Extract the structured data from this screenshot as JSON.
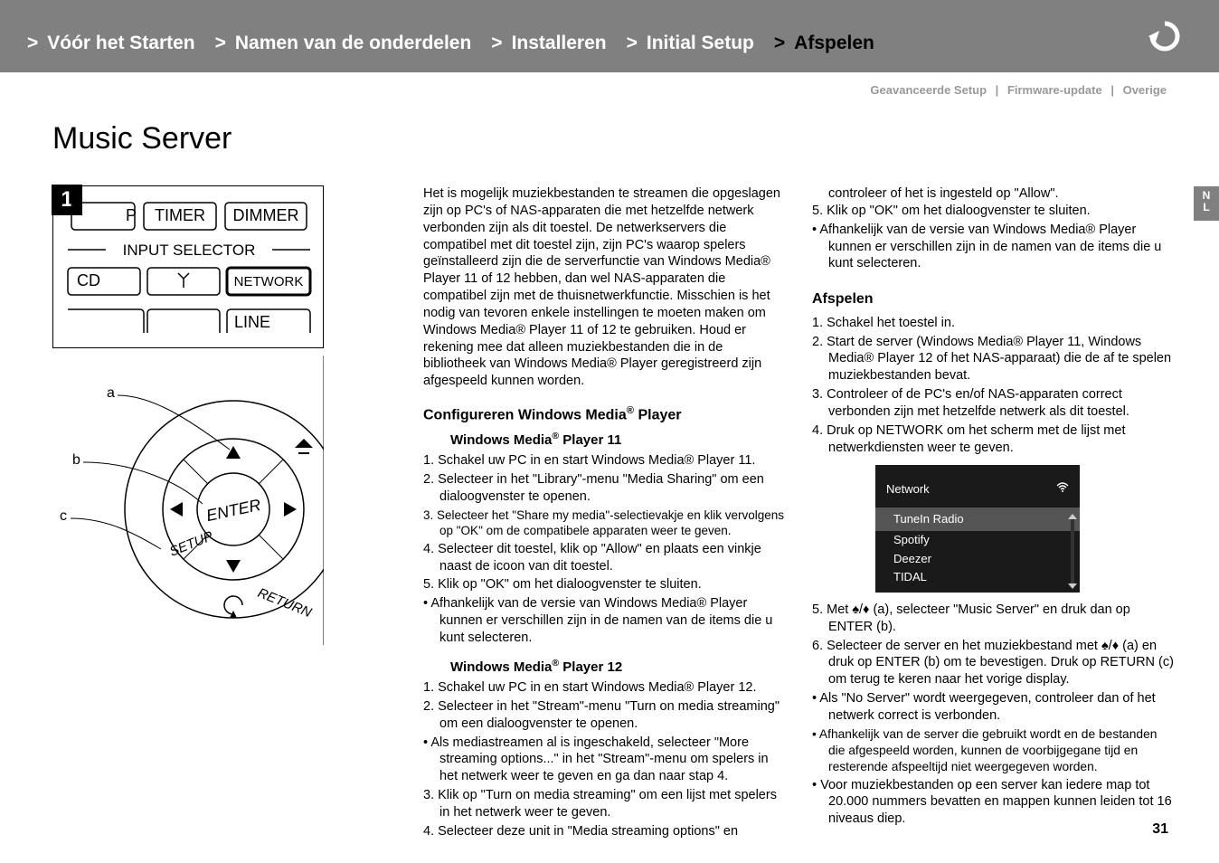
{
  "breadcrumbs": [
    {
      "label": "Vóór het Starten"
    },
    {
      "label": "Namen van de onderdelen"
    },
    {
      "label": "Installeren"
    },
    {
      "label": "Initial Setup"
    },
    {
      "label": "Afspelen",
      "active": true
    }
  ],
  "sublinks": {
    "a": "Geavanceerde Setup",
    "b": "Firmware-update",
    "c": "Overige"
  },
  "title": "Music Server",
  "lang_tab": "N\nL",
  "page_number": "31",
  "diagram1": {
    "step": "1",
    "btn_p": "P",
    "btn_timer": "TIMER",
    "btn_dimmer": "DIMMER",
    "input_selector": "INPUT SELECTOR",
    "btn_cd": "CD",
    "btn_network": "NETWORK",
    "line": "LINE"
  },
  "diagram2": {
    "label_a": "a",
    "label_b": "b",
    "label_c": "c",
    "enter": "ENTER",
    "setup": "SETUP",
    "return": "RETURN"
  },
  "mid": {
    "intro": "Het is mogelijk muziekbestanden te streamen die opgeslagen zijn op PC's of NAS-apparaten die met hetzelfde netwerk verbonden zijn als dit toestel. De netwerkservers die compatibel met dit toestel zijn, zijn PC's waarop spelers geïnstalleerd zijn die de serverfunctie van Windows Media® Player 11 of 12 hebben, dan wel NAS-apparaten die compatibel zijn met de thuisnetwerkfunctie. Misschien is het nodig van tevoren enkele instellingen te moeten maken om Windows Media® Player 11 of 12 te gebruiken. Houd er rekening mee dat alleen muziekbestanden die in de bibliotheek van Windows Media® Player geregistreerd zijn afgespeeld kunnen worden.",
    "h_config": "Configureren Windows Media® Player",
    "h_wmp11": "Windows Media® Player 11",
    "wmp11": {
      "s1": "1. Schakel uw PC in en start Windows Media® Player 11.",
      "s2": "2. Selecteer in het \"Library\"-menu \"Media Sharing\" om een dialoogvenster te openen.",
      "s3": "3. Selecteer het \"Share my media\"-selectievakje en klik vervolgens op \"OK\" om de compatibele apparaten weer te geven.",
      "s4": "4. Selecteer dit toestel, klik op \"Allow\" en plaats een vinkje naast de icoon van dit toestel.",
      "s5": "5. Klik op \"OK\" om het dialoogvenster te sluiten.",
      "b1": "Afhankelijk van de versie van Windows Media® Player kunnen er verschillen zijn in de namen van de items die u kunt selecteren."
    },
    "h_wmp12": "Windows Media® Player 12",
    "wmp12": {
      "s1": "1. Schakel uw PC in en start Windows Media® Player 12.",
      "s2": "2. Selecteer in het \"Stream\"-menu \"Turn on media streaming\" om een dialoogvenster te openen.",
      "b2a": "Als mediastreamen al is ingeschakeld, selecteer \"More streaming options...\" in het \"Stream\"-menu om spelers in het netwerk weer te geven en ga dan naar stap 4.",
      "s3": "3. Klik op \"Turn on media streaming\" om een lijst met spelers in het netwerk weer te geven.",
      "s4": "4. Selecteer deze unit in \"Media streaming options\" en"
    }
  },
  "right": {
    "cont1": "controleer of het is ingesteld op \"Allow\".",
    "s5r": "5. Klik op \"OK\" om het dialoogvenster te sluiten.",
    "b1r": "Afhankelijk van de versie van Windows Media® Player kunnen er verschillen zijn in de namen van de items die u kunt selecteren.",
    "h_afspelen": "Afspelen",
    "af": {
      "s1": "1. Schakel het toestel in.",
      "s2": "2. Start de server (Windows Media® Player 11, Windows Media® Player 12 of het NAS-apparaat) die de af te spelen muziekbestanden bevat.",
      "s3": "3. Controleer of de PC's en/of NAS-apparaten correct verbonden zijn met hetzelfde netwerk als dit toestel.",
      "s4": "4. Druk op NETWORK om het scherm met de lijst met netwerkdiensten weer te geven."
    },
    "networkbox": {
      "title": "Network",
      "sel": "TuneIn Radio",
      "i1": "Spotify",
      "i2": "Deezer",
      "i3": "TIDAL"
    },
    "af2": {
      "s5": "5. Met ♠/♦ (a), selecteer \"Music Server\" en druk dan op ENTER (b).",
      "s6": "6. Selecteer de server en het muziekbestand met ♠/♦ (a) en druk op ENTER (b) om te bevestigen. Druk op RETURN (c) om terug te keren naar het vorige display.",
      "b1": "Als \"No Server\" wordt weergegeven, controleer dan of het netwerk correct is verbonden.",
      "b2": "Afhankelijk van de server die gebruikt wordt en de bestanden die afgespeeld worden, kunnen de voorbijgegane tijd en resterende afspeeltijd niet weergegeven worden.",
      "b3": "Voor muziekbestanden op een server kan iedere map tot 20.000 nummers bevatten en mappen kunnen leiden tot 16 niveaus diep."
    }
  }
}
